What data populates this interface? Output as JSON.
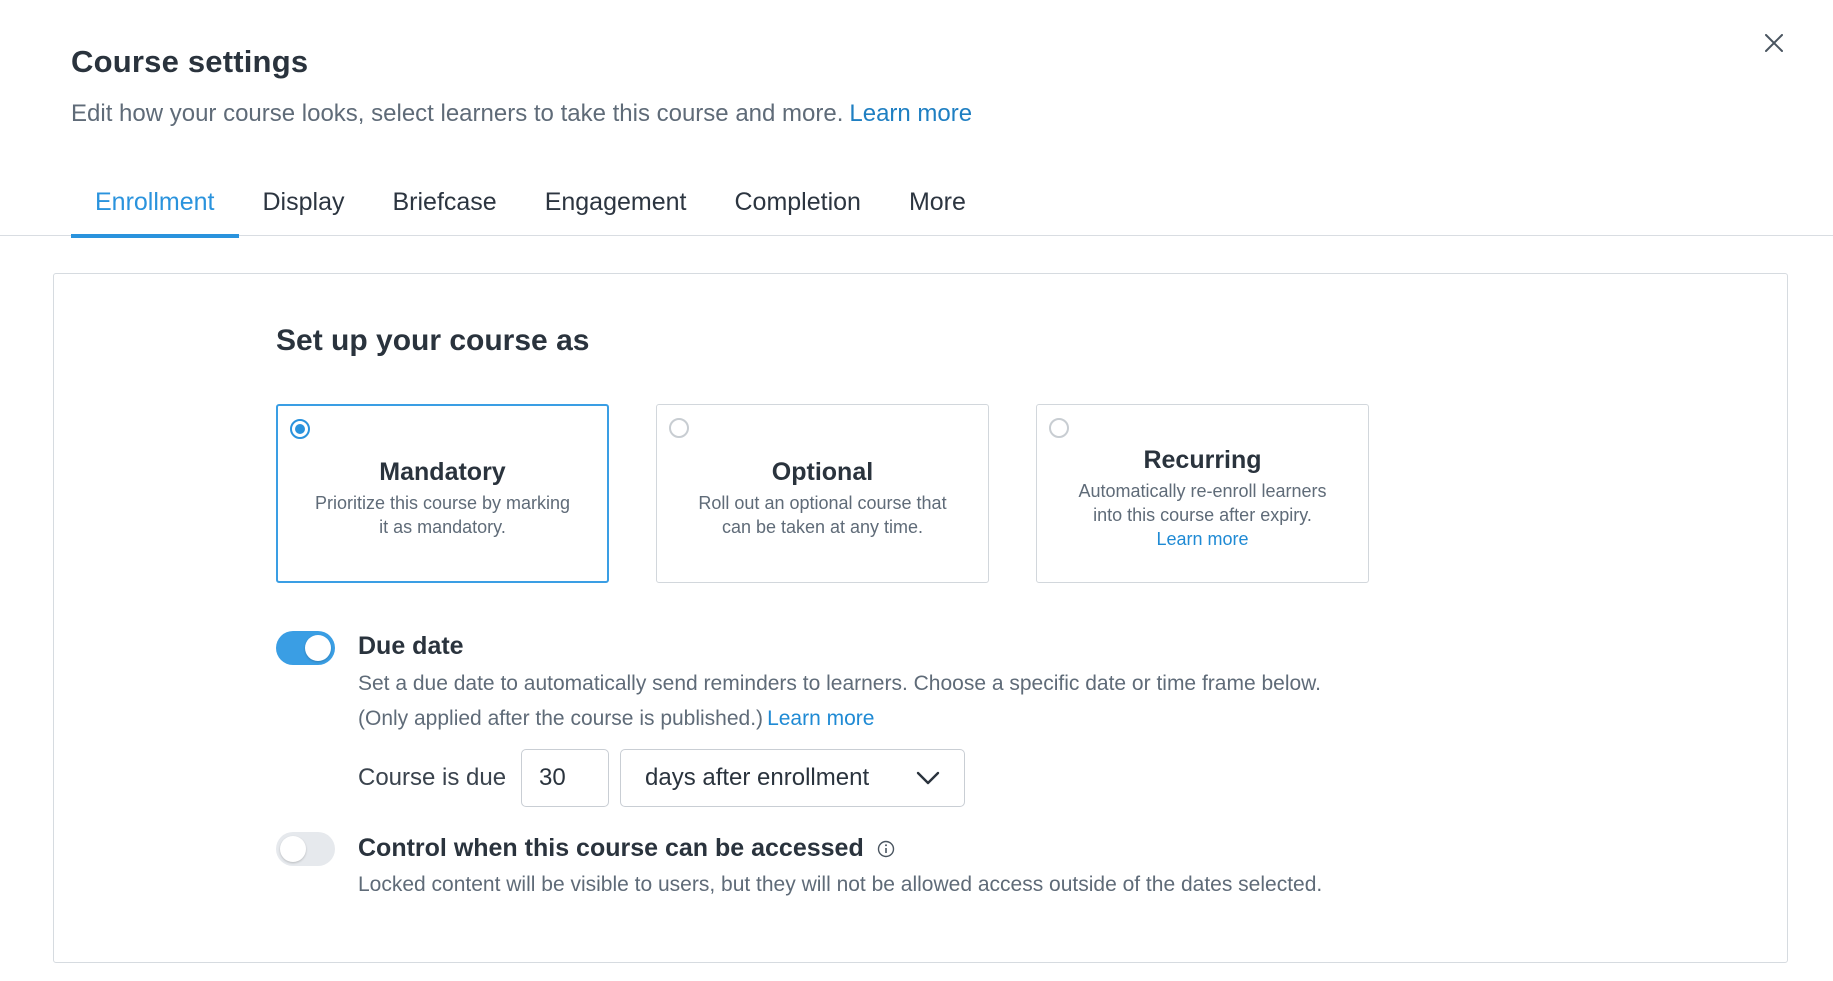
{
  "header": {
    "title": "Course settings",
    "subtitle": "Edit how your course looks, select learners to take this course and more.",
    "subtitle_link": "Learn more"
  },
  "tabs": [
    {
      "label": "Enrollment",
      "active": true
    },
    {
      "label": "Display"
    },
    {
      "label": "Briefcase"
    },
    {
      "label": "Engagement"
    },
    {
      "label": "Completion"
    },
    {
      "label": "More"
    }
  ],
  "section": {
    "title": "Set up your course as"
  },
  "course_types": [
    {
      "title": "Mandatory",
      "desc": "Prioritize this course by marking it as mandatory.",
      "selected": true
    },
    {
      "title": "Optional",
      "desc": "Roll out an optional course that can be taken at any time.",
      "selected": false
    },
    {
      "title": "Recurring",
      "desc": "Automatically re-enroll learners into this course after expiry.",
      "link": "Learn more",
      "selected": false
    }
  ],
  "due_date": {
    "enabled": true,
    "title": "Due date",
    "desc_line1": "Set a due date to automatically send reminders to learners. Choose a specific date or time frame below.",
    "desc_line2": "(Only applied after the course is published.)",
    "link": "Learn more",
    "course_is_due_label": "Course is due",
    "days_value": "30",
    "frame_select": "days after enrollment"
  },
  "access_control": {
    "enabled": false,
    "title": "Control when this course can be accessed",
    "desc": "Locked content will be visible to users, but they will not be allowed access outside of the dates selected."
  },
  "colors": {
    "accent": "#2a93dd",
    "link": "#1f7fc2",
    "toggle_off": "#e6e9ed"
  }
}
